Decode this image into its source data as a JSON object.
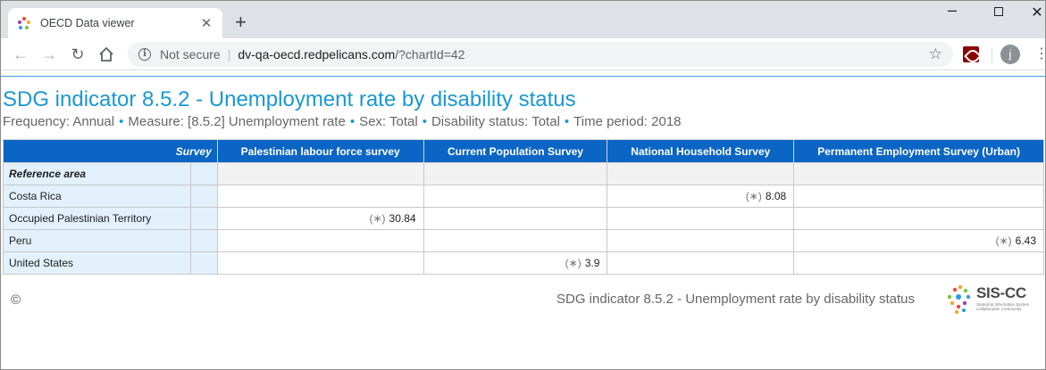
{
  "browser": {
    "tab_title": "OECD Data viewer",
    "new_tab_glyph": "+",
    "url_security": "Not secure",
    "url_host": "dv-qa-oecd.redpelicans.com",
    "url_path": "/?chartId=42",
    "avatar_letter": "j"
  },
  "chart": {
    "title": "SDG indicator 8.5.2 - Unemployment rate by disability status",
    "filters": [
      "Frequency: Annual",
      "Measure: [8.5.2] Unemployment rate",
      "Sex: Total",
      "Disability status: Total",
      "Time period: 2018"
    ],
    "accent_color": "#1a97d4",
    "header_color": "#0b65c4"
  },
  "table": {
    "column_dimension_label": "Survey",
    "row_dimension_label": "Reference area",
    "columns": [
      "Palestinian labour force survey",
      "Current Population Survey",
      "National Household Survey",
      "Permanent Employment Survey (Urban)"
    ],
    "flag_symbol": "(∗)",
    "rows": [
      {
        "label": "Costa Rica",
        "values": [
          "",
          "",
          "8.08",
          ""
        ]
      },
      {
        "label": "Occupied Palestinian Territory",
        "values": [
          "30.84",
          "",
          "",
          ""
        ]
      },
      {
        "label": "Peru",
        "values": [
          "",
          "",
          "",
          "6.43"
        ]
      },
      {
        "label": "United States",
        "values": [
          "",
          "3.9",
          "",
          ""
        ]
      }
    ]
  },
  "chart_data": {
    "type": "table",
    "title": "SDG indicator 8.5.2 - Unemployment rate by disability status",
    "columns": [
      "Palestinian labour force survey",
      "Current Population Survey",
      "National Household Survey",
      "Permanent Employment Survey (Urban)"
    ],
    "rows": [
      "Costa Rica",
      "Occupied Palestinian Territory",
      "Peru",
      "United States"
    ],
    "values": [
      [
        null,
        null,
        8.08,
        null
      ],
      [
        30.84,
        null,
        null,
        null
      ],
      [
        null,
        null,
        null,
        6.43
      ],
      [
        null,
        3.9,
        null,
        null
      ]
    ]
  },
  "footer": {
    "copyright": "©",
    "title": "SDG indicator 8.5.2 - Unemployment rate by disability status",
    "logo_text": "SIS-CC",
    "logo_sub": "Statistical Information System Collaboration Community"
  }
}
